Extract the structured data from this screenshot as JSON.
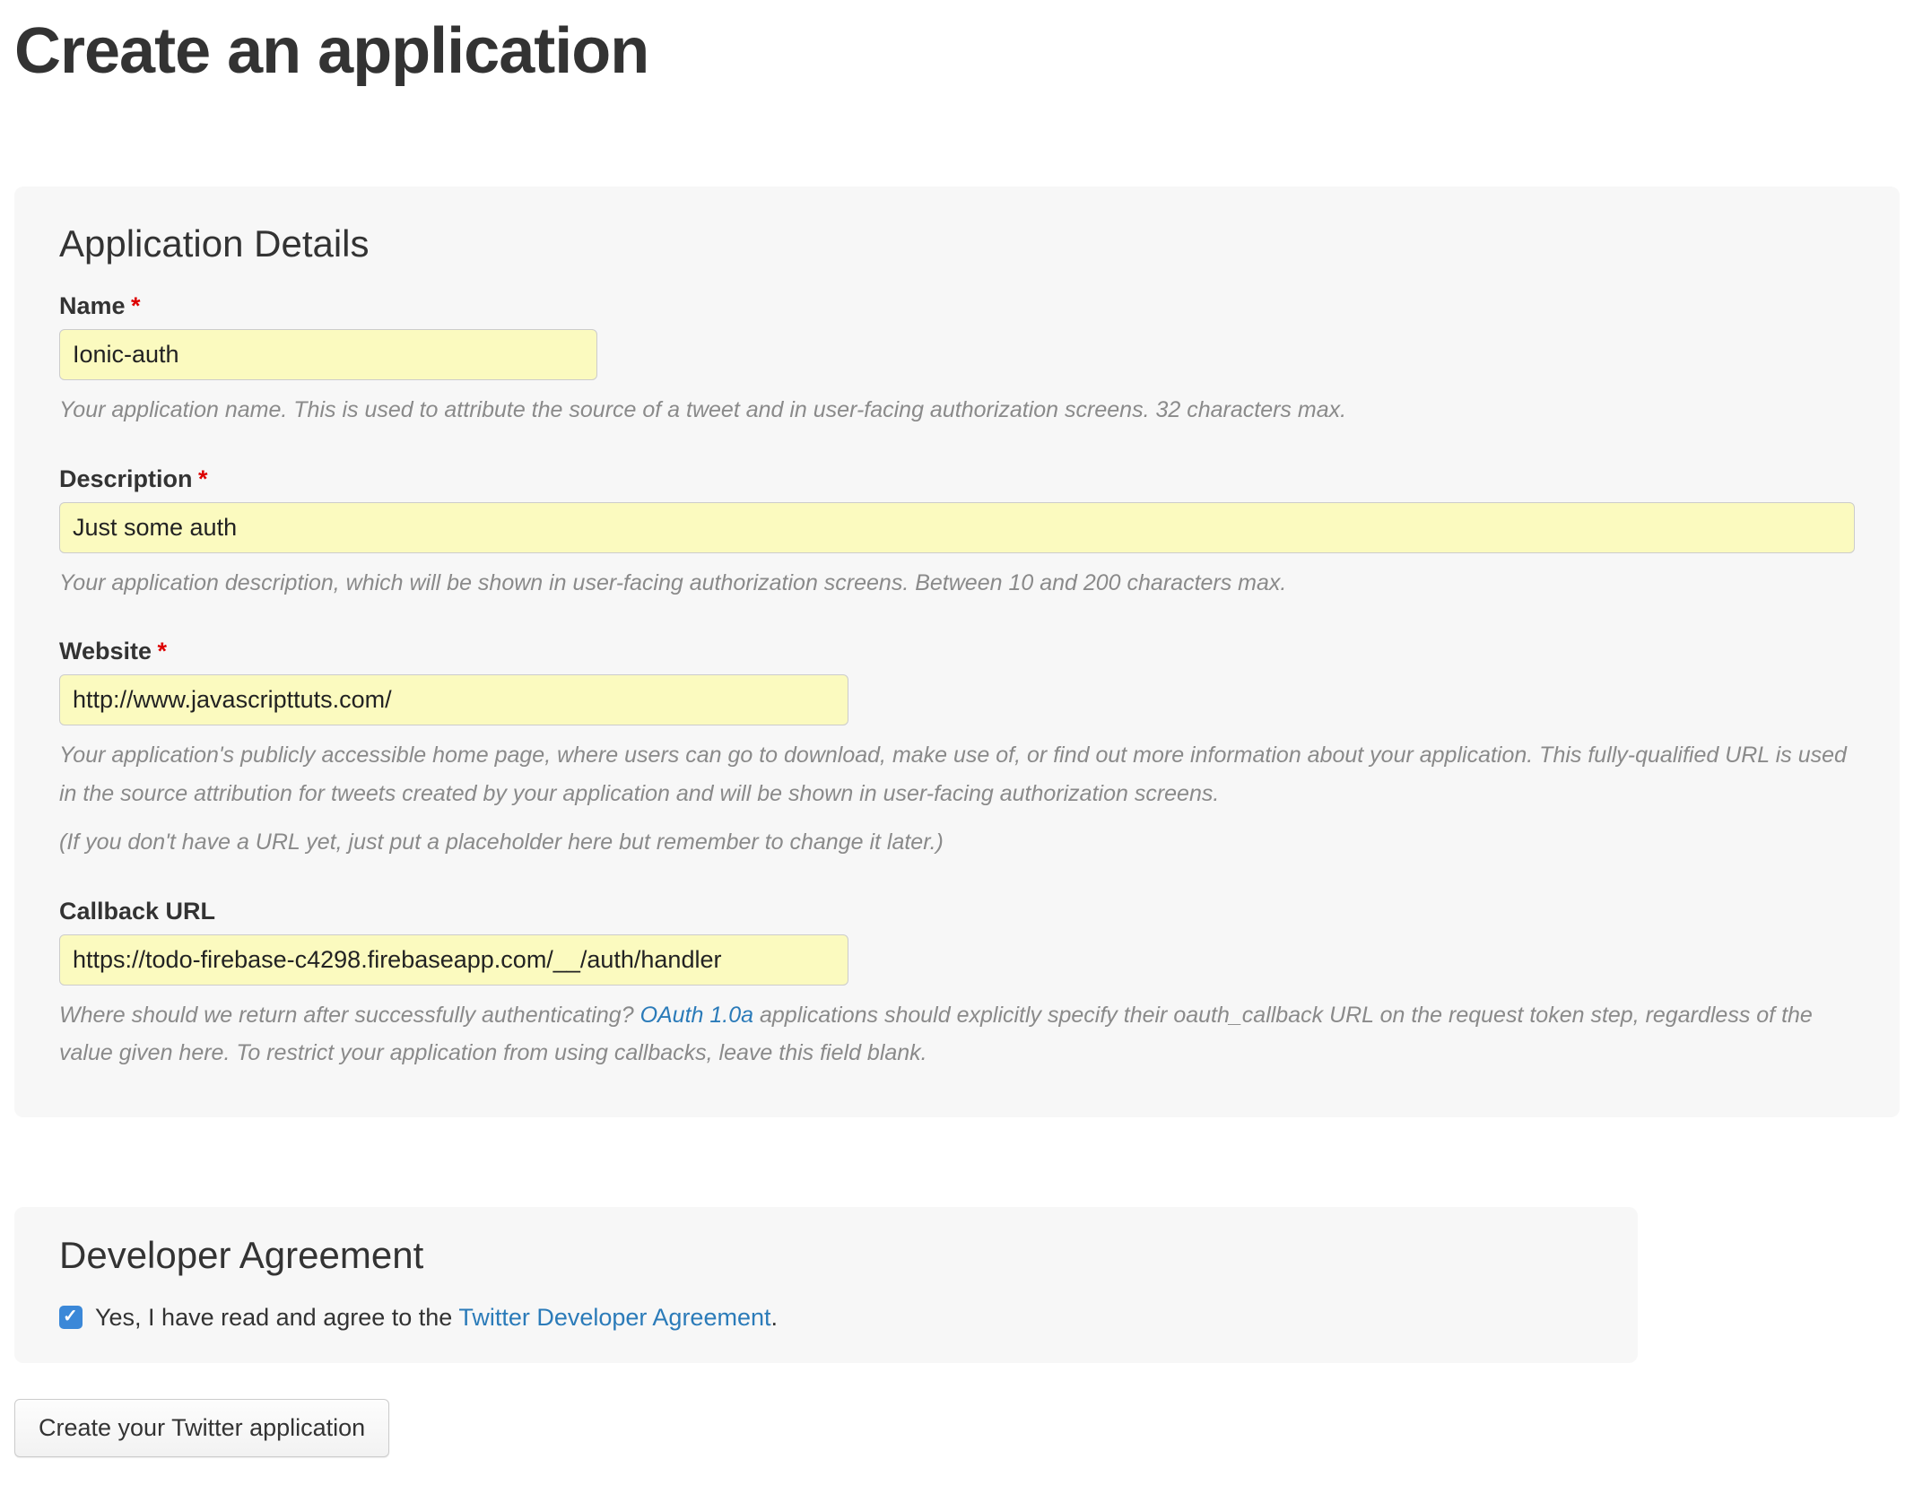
{
  "page": {
    "title": "Create an application"
  },
  "details": {
    "heading": "Application Details",
    "name": {
      "label": "Name",
      "value": "Ionic-auth",
      "help": "Your application name. This is used to attribute the source of a tweet and in user-facing authorization screens. 32 characters max."
    },
    "description": {
      "label": "Description",
      "value": "Just some auth",
      "help": "Your application description, which will be shown in user-facing authorization screens. Between 10 and 200 characters max."
    },
    "website": {
      "label": "Website",
      "value": "http://www.javascripttuts.com/",
      "help1": "Your application's publicly accessible home page, where users can go to download, make use of, or find out more information about your application. This fully-qualified URL is used in the source attribution for tweets created by your application and will be shown in user-facing authorization screens.",
      "help2": "(If you don't have a URL yet, just put a placeholder here but remember to change it later.)"
    },
    "callback": {
      "label": "Callback URL",
      "value": "https://todo-firebase-c4298.firebaseapp.com/__/auth/handler",
      "help_before": "Where should we return after successfully authenticating? ",
      "help_link": "OAuth 1.0a",
      "help_after": " applications should explicitly specify their oauth_callback URL on the request token step, regardless of the value given here. To restrict your application from using callbacks, leave this field blank."
    }
  },
  "agreement": {
    "heading": "Developer Agreement",
    "text_before": "Yes, I have read and agree to the ",
    "link": "Twitter Developer Agreement",
    "text_after": "."
  },
  "submit": {
    "label": "Create your Twitter application"
  },
  "required_star": "*"
}
